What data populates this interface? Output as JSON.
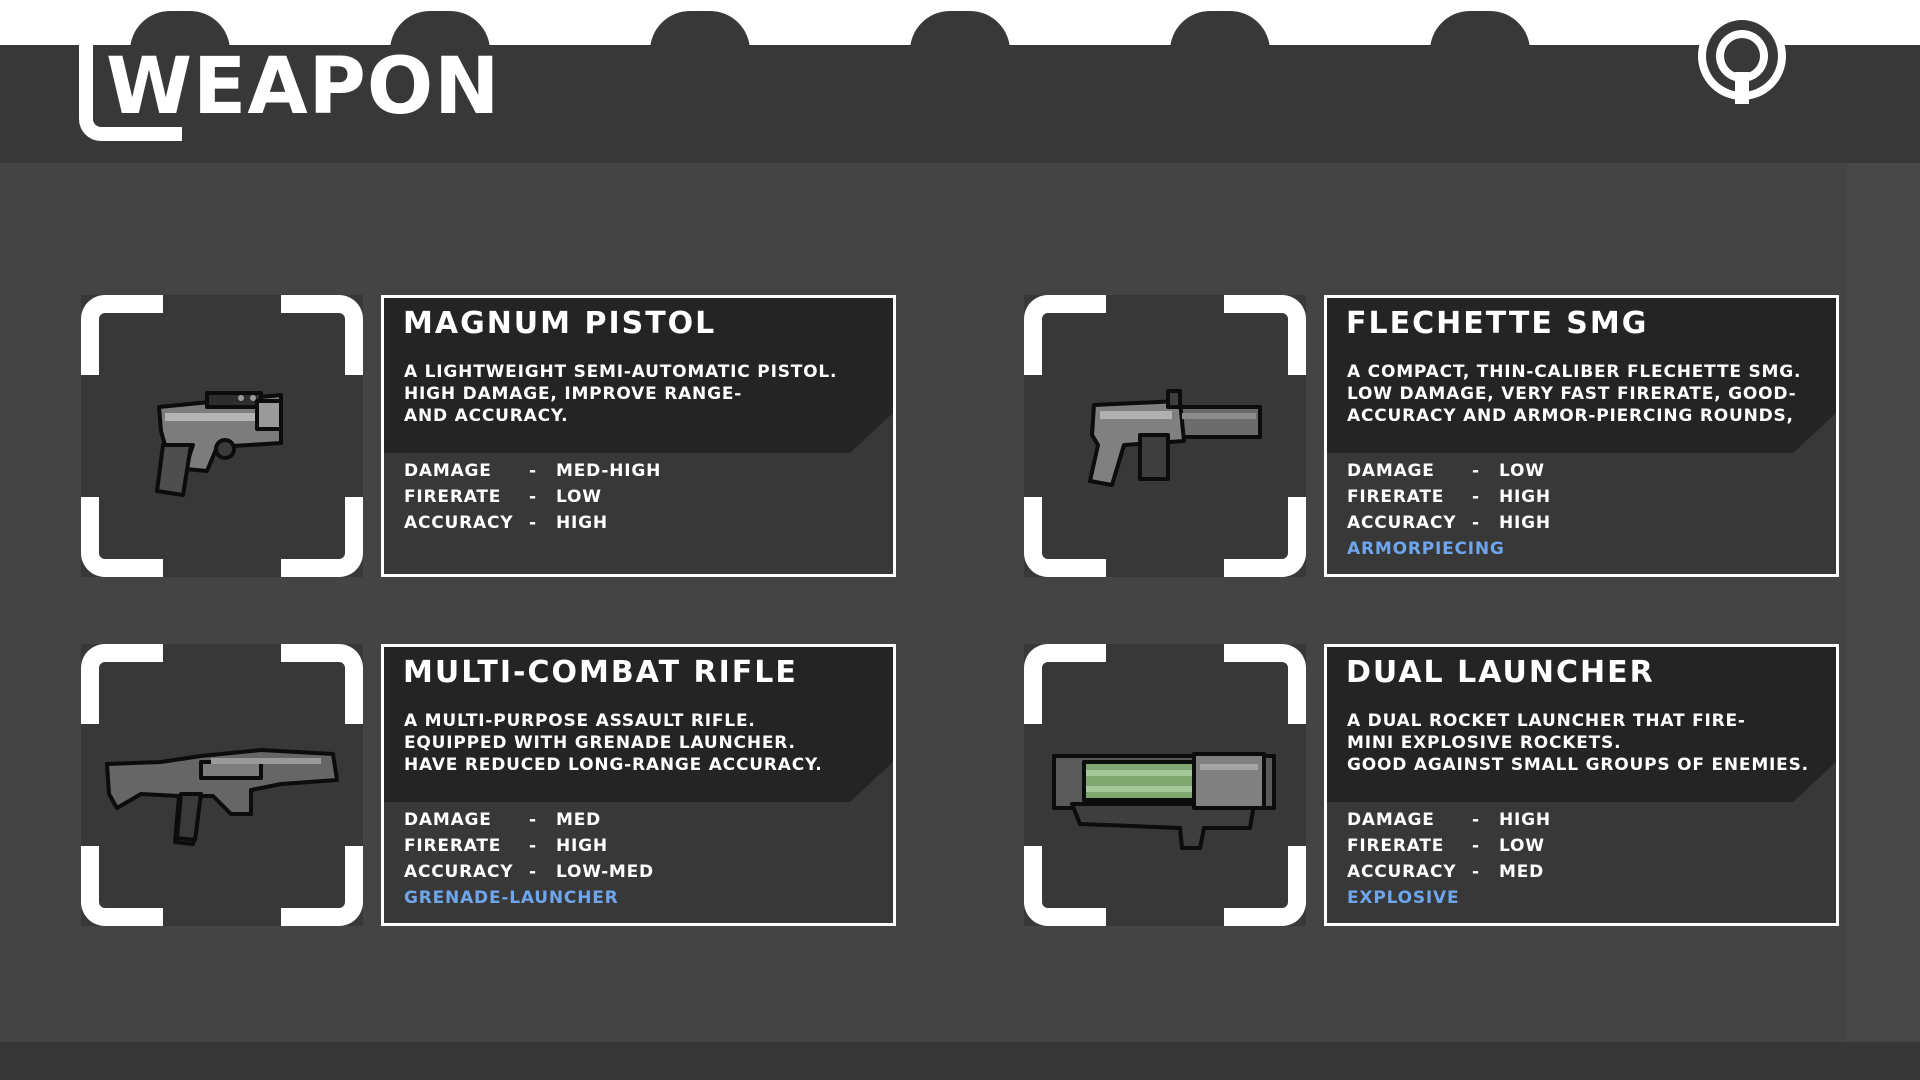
{
  "header": {
    "title": "WEAPON"
  },
  "weapons": [
    {
      "name": "MAGNUM PISTOL",
      "description": "A LIGHTWEIGHT SEMI-AUTOMATIC PISTOL.\nHIGH DAMAGE, IMPROVE RANGE-\nAND ACCURACY.",
      "stats": [
        {
          "label": "DAMAGE",
          "sep": "-",
          "value": "MED-HIGH"
        },
        {
          "label": "FIRERATE",
          "sep": "-",
          "value": "LOW"
        },
        {
          "label": "ACCURACY",
          "sep": "-",
          "value": "HIGH"
        }
      ],
      "tag": ""
    },
    {
      "name": "FLECHETTE SMG",
      "description": "A COMPACT, THIN-CALIBER FLECHETTE SMG.\nLOW DAMAGE, VERY FAST FIRERATE, GOOD-\nACCURACY AND ARMOR-PIERCING ROUNDS,",
      "stats": [
        {
          "label": "DAMAGE",
          "sep": "-",
          "value": "LOW"
        },
        {
          "label": "FIRERATE",
          "sep": "-",
          "value": "HIGH"
        },
        {
          "label": "ACCURACY",
          "sep": "-",
          "value": "HIGH"
        }
      ],
      "tag": "ARMORPIECING"
    },
    {
      "name": "MULTI-COMBAT RIFLE",
      "description": "A MULTI-PURPOSE ASSAULT RIFLE.\nEQUIPPED WITH GRENADE LAUNCHER.\nHAVE REDUCED LONG-RANGE ACCURACY.",
      "stats": [
        {
          "label": "DAMAGE",
          "sep": "-",
          "value": "MED"
        },
        {
          "label": "FIRERATE",
          "sep": "-",
          "value": "HIGH"
        },
        {
          "label": "ACCURACY",
          "sep": "-",
          "value": "LOW-MED"
        }
      ],
      "tag": "GRENADE-LAUNCHER"
    },
    {
      "name": "DUAL LAUNCHER",
      "description": "A DUAL ROCKET LAUNCHER THAT FIRE-\nMINI EXPLOSIVE ROCKETS.\nGOOD AGAINST SMALL GROUPS OF ENEMIES.",
      "stats": [
        {
          "label": "DAMAGE",
          "sep": "-",
          "value": "HIGH"
        },
        {
          "label": "FIRERATE",
          "sep": "-",
          "value": "LOW"
        },
        {
          "label": "ACCURACY",
          "sep": "-",
          "value": "MED"
        }
      ],
      "tag": "EXPLOSIVE"
    }
  ],
  "colors": {
    "tag": "#6ea6ee",
    "panel": "#383838",
    "panel_dark": "#242424",
    "background": "#444444",
    "launcher_tubes": "#7fa870"
  }
}
